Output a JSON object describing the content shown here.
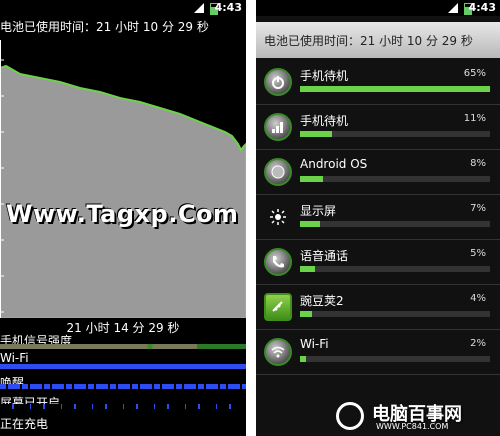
{
  "status_bar": {
    "time": "4:43"
  },
  "left": {
    "battery_usage_title": "电池已使用时间：21 小时 10 分 29 秒",
    "watermark": "Www.Tagxp.Com",
    "graph_time": "21 小时 14 分 29 秒",
    "signal_rows": [
      {
        "label": "手机信号强度"
      },
      {
        "label": "Wi-Fi"
      },
      {
        "label": "唤醒"
      },
      {
        "label": "屏幕已开启"
      },
      {
        "label": "正在充电"
      }
    ]
  },
  "right": {
    "header": "电池已使用时间：21 小时 10 分 29 秒",
    "apps": [
      {
        "name": "手机待机",
        "percent": "65%",
        "value": 65,
        "icon": "power-icon"
      },
      {
        "name": "手机待机",
        "percent": "11%",
        "value": 11,
        "icon": "signal-icon"
      },
      {
        "name": "Android OS",
        "percent": "8%",
        "value": 8,
        "icon": "android-os-icon"
      },
      {
        "name": "显示屏",
        "percent": "7%",
        "value": 7,
        "icon": "brightness-icon"
      },
      {
        "name": "语音通话",
        "percent": "5%",
        "value": 5,
        "icon": "phone-icon"
      },
      {
        "name": "豌豆荚2",
        "percent": "4%",
        "value": 4,
        "icon": "wandoujia-icon"
      },
      {
        "name": "Wi-Fi",
        "percent": "2%",
        "value": 2,
        "icon": "wifi-icon"
      }
    ],
    "logo": {
      "title": "电脑百事网",
      "url": "WWW.PC841.COM"
    }
  },
  "colors": {
    "accent_green": "#6cd24a",
    "graph_gray": "#9a9a9a",
    "signal_blue": "#2e4df0"
  }
}
